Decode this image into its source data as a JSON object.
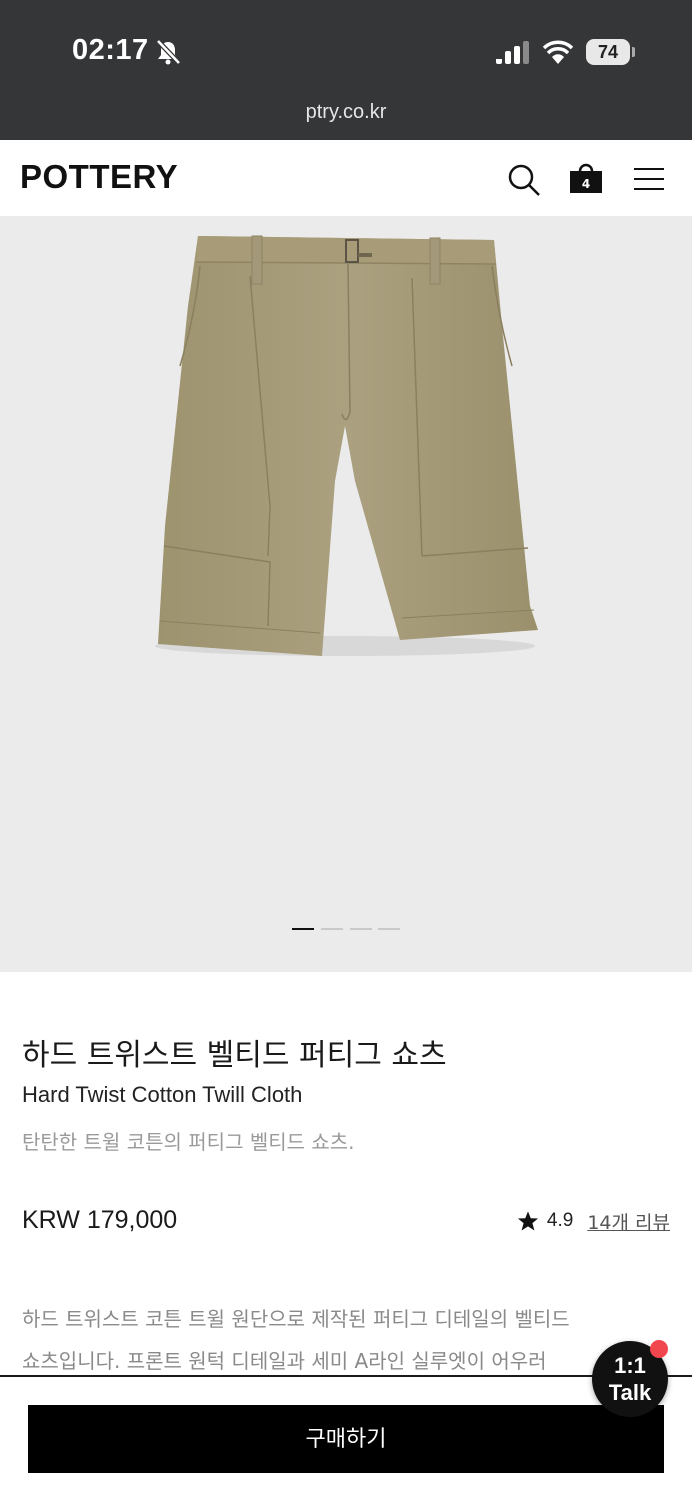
{
  "status_bar": {
    "time": "02:17",
    "battery": "74",
    "icons": [
      "bell-slash-icon",
      "cellular-signal-icon",
      "wifi-icon",
      "battery-icon"
    ]
  },
  "browser": {
    "url": "ptry.co.kr"
  },
  "header": {
    "logo": "POTTERY",
    "cart_count": "4",
    "icons": [
      "search-icon",
      "shopping-bag-icon",
      "hamburger-menu-icon"
    ]
  },
  "gallery": {
    "slide_count": 4,
    "active_slide": 1
  },
  "product": {
    "name_ko": "하드 트위스트 벨티드 퍼티그 쇼츠",
    "name_en": "Hard Twist Cotton Twill Cloth",
    "subtitle": "탄탄한 트윌 코튼의 퍼티그 벨티드 쇼츠.",
    "price": "KRW 179,000",
    "rating": "4.9",
    "review_link": "14개 리뷰",
    "description_line1": "하드 트위스트 코튼 트윌 원단으로 제작된 퍼티그 디테일의 벨티드",
    "description_line2": "쇼츠입니다. 프론트 원턱 디테일과 세미 A라인 실루엣이 어우러"
  },
  "actions": {
    "buy_label": "구매하기",
    "talk_line1": "1:1",
    "talk_line2": "Talk"
  },
  "colors": {
    "status_bar_bg": "#343638",
    "gallery_bg": "#ebebeb",
    "product_khaki": "#a59a7a",
    "buy_button_bg": "#000000",
    "notification_dot": "#f2464f"
  }
}
